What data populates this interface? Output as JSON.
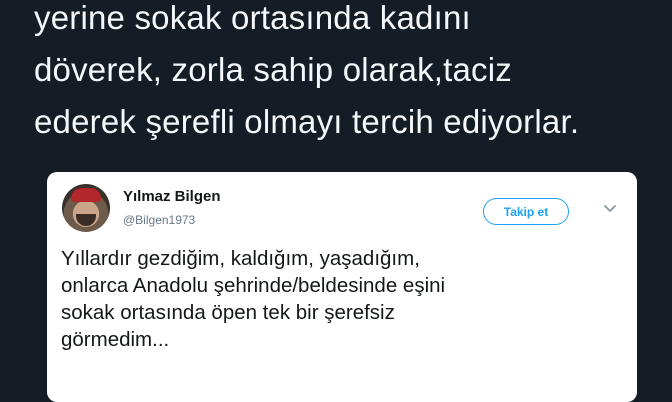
{
  "outer_tweet": {
    "lines": [
      "yerine sokak ortasında kadını",
      "döverek, zorla sahip olarak,taciz",
      "ederek şerefli olmayı tercih ediyorlar."
    ]
  },
  "quoted_tweet": {
    "display_name": "Yılmaz Bilgen",
    "handle": "@Bilgen1973",
    "follow_label": "Takip et",
    "lines": [
      "Yıllardır gezdiğim, kaldığım, yaşadığım,",
      "onlarca Anadolu şehrinde/beldesinde eşini",
      "sokak ortasında öpen tek bir şerefsiz",
      "görmedim..."
    ]
  },
  "icons": {
    "avatar": "profile-photo",
    "menu": "chevron-down-icon"
  },
  "colors": {
    "background": "#141d26",
    "outer_text": "#f5f8fa",
    "card_background": "#ffffff",
    "accent": "#1da1f2",
    "handle": "#657786",
    "body_text": "#14171a"
  }
}
